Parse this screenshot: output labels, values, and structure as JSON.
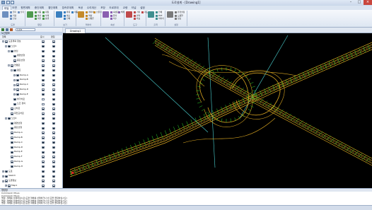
{
  "window": {
    "title": "도로설계 - [Drawing1]"
  },
  "menu_tabs": [
    "파일",
    "도면",
    "평면계획",
    "종단계획",
    "횡단계획",
    "접속부계획",
    "토공",
    "수리계산",
    "포장",
    "도로부대",
    "교량",
    "터널",
    "설정"
  ],
  "ribbon_groups": [
    {
      "label": "도면",
      "items": [
        "열기",
        "저장",
        "신규",
        "닫기"
      ]
    },
    {
      "label": "편집",
      "items": [
        "이동",
        "복사",
        "회전",
        "대칭",
        "삭제",
        "옵셋"
      ]
    },
    {
      "label": "보기",
      "items": [
        "확대",
        "축소",
        "전체",
        "이동"
      ]
    },
    {
      "label": "레이어",
      "items": [
        "레이어",
        "색상",
        "선종류",
        "선굵기"
      ]
    },
    {
      "label": "속성",
      "items": [
        "속성창",
        "문자",
        "치수",
        "해치"
      ]
    },
    {
      "label": "도구",
      "items": [
        "거리",
        "면적",
        "좌표",
        "각도"
      ]
    },
    {
      "label": "출력",
      "items": [
        "인쇄",
        "PDF",
        "이미지"
      ]
    },
    {
      "label": "설정",
      "items": [
        "환경설정",
        "도움말",
        "정보"
      ]
    }
  ],
  "panel": {
    "combo_value": "노선1",
    "caption": "노선정보",
    "title": "항목",
    "col_visible": "표시",
    "col_edit": "편집"
  },
  "tree": [
    {
      "level": 0,
      "label": "도로계획 정보",
      "exp": "-",
      "visible": true,
      "edit": true
    },
    {
      "level": 1,
      "label": "노선1",
      "exp": "-",
      "visible": true,
      "edit": true
    },
    {
      "level": 2,
      "label": "본선",
      "exp": "-",
      "visible": true,
      "edit": true
    },
    {
      "level": 3,
      "label": "평면선형",
      "exp": "",
      "visible": true,
      "edit": true
    },
    {
      "level": 3,
      "label": "종단선형",
      "exp": "",
      "visible": true,
      "edit": true
    },
    {
      "level": 2,
      "label": "연결로",
      "exp": "-",
      "visible": true,
      "edit": true
    },
    {
      "level": 3,
      "label": "램프",
      "exp": "-",
      "visible": true,
      "edit": true
    },
    {
      "level": 4,
      "label": "Ramp-A",
      "exp": "+",
      "visible": true,
      "edit": true
    },
    {
      "level": 4,
      "label": "Ramp-B",
      "exp": "+",
      "visible": true,
      "edit": true
    },
    {
      "level": 4,
      "label": "Ramp-C",
      "exp": "+",
      "visible": true,
      "edit": true
    },
    {
      "level": 4,
      "label": "Ramp-D",
      "exp": "+",
      "visible": true,
      "edit": true
    },
    {
      "level": 4,
      "label": "Ramp-E",
      "exp": "+",
      "visible": true,
      "edit": true
    },
    {
      "level": 3,
      "label": "부가차로",
      "exp": "",
      "visible": false,
      "edit": true
    },
    {
      "level": 3,
      "label": "노즈 정의",
      "exp": "",
      "visible": false,
      "edit": true
    },
    {
      "level": 2,
      "label": "교차로",
      "exp": "",
      "visible": true,
      "edit": true
    },
    {
      "level": 2,
      "label": "회전교차로",
      "exp": "",
      "visible": true,
      "edit": true
    },
    {
      "level": 1,
      "label": "노선2",
      "exp": "-",
      "visible": true,
      "edit": true
    },
    {
      "level": 2,
      "label": "평면선형",
      "exp": "",
      "visible": true,
      "edit": true
    },
    {
      "level": 2,
      "label": "종단선형",
      "exp": "",
      "visible": true,
      "edit": true
    },
    {
      "level": 2,
      "label": "Ramp-A",
      "exp": "",
      "visible": true,
      "edit": true
    },
    {
      "level": 2,
      "label": "Ramp-B",
      "exp": "",
      "visible": true,
      "edit": true
    },
    {
      "level": 2,
      "label": "Ramp-C",
      "exp": "",
      "visible": true,
      "edit": true
    },
    {
      "level": 2,
      "label": "Ramp-D",
      "exp": "",
      "visible": true,
      "edit": true
    },
    {
      "level": 2,
      "label": "Ramp-E",
      "exp": "",
      "visible": true,
      "edit": true
    },
    {
      "level": 2,
      "label": "Ramp-F",
      "exp": "",
      "visible": true,
      "edit": true
    },
    {
      "level": 2,
      "label": "Ramp-G",
      "exp": "",
      "visible": true,
      "edit": true
    },
    {
      "level": 2,
      "label": "Ramp-H",
      "exp": "",
      "visible": true,
      "edit": true
    },
    {
      "level": 0,
      "label": "도로",
      "exp": "+",
      "visible": true,
      "edit": true
    },
    {
      "level": 0,
      "label": "Sketch",
      "exp": "+",
      "visible": true,
      "edit": true
    },
    {
      "level": 0,
      "label": "도면정보",
      "exp": "+",
      "visible": true,
      "edit": true
    },
    {
      "level": 1,
      "label": "Map1",
      "exp": "+",
      "visible": true,
      "edit": true
    }
  ],
  "document": {
    "tab": "Drawing1"
  },
  "command": {
    "caption": "명령창",
    "lines": [
      "Command: Move",
      "Command: Move",
      "명령: 객체를 선택하십시오(도면 객체를 선택하거나 빈 곳을 클릭하십시오)",
      "명령: 객체를 선택하십시오(도면 객체를 선택하거나 빈 곳을 클릭하십시오)",
      "명령: 객체를 선택하십시오(도면 객체를 선택하거나 빈 곳을 클릭하십시오)"
    ]
  },
  "colors": {
    "canvas": "#000000",
    "road_edge": "#d9a520",
    "centerline": "#f3c24a",
    "annotation": "#2dd82d",
    "guide": "#4bd2d2",
    "marker": "#dd2222"
  }
}
